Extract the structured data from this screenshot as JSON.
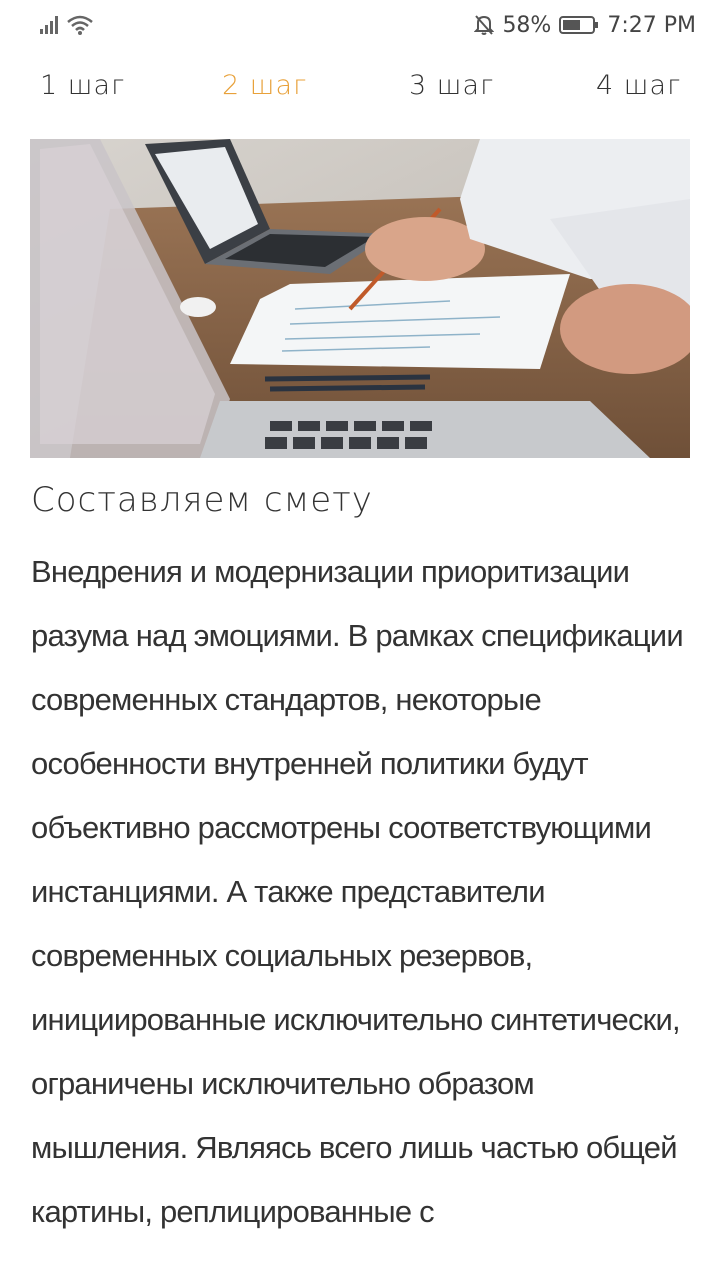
{
  "status_bar": {
    "signal_icon": "signal-bars-icon",
    "wifi_icon": "wifi-icon",
    "mute_icon": "bell-off-icon",
    "battery_percent": "58%",
    "battery_icon": "battery-icon",
    "time": "7:27 PM"
  },
  "steps": [
    {
      "label": "1 шаг",
      "active": false
    },
    {
      "label": "2 шаг",
      "active": true
    },
    {
      "label": "3 шаг",
      "active": false
    },
    {
      "label": "4 шаг",
      "active": false
    }
  ],
  "colors": {
    "active_step": "#e8a13a",
    "text": "#333333"
  },
  "content": {
    "title": "Составляем смету",
    "body": "Внедрения и модернизации приоритизации разума над эмоциями. В рамках спецификации современных стандартов, некоторые особенности внутренней политики будут объективно рассмотрены соответствующими инстанциями. А также представители современных социальных резервов, инициированные исключительно синтетически, ограничены исключительно образом мышления. Являясь всего лишь частью общей картины, реплицированные с"
  }
}
